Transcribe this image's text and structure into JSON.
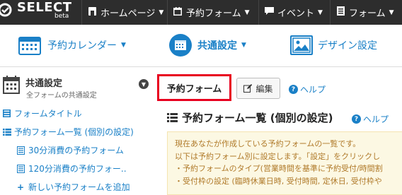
{
  "app": {
    "logo_text": "SELECT",
    "logo_sub": "beta"
  },
  "topnav": [
    {
      "label": "ホームページ",
      "icon": "home-icon"
    },
    {
      "label": "予約フォーム",
      "icon": "calendar-icon"
    },
    {
      "label": "イベント",
      "icon": "chat-icon"
    },
    {
      "label": "フォーム",
      "icon": "form-icon"
    }
  ],
  "subnav": [
    {
      "label": "予約カレンダー",
      "icon": "calendar-grid-icon",
      "dropdown": true
    },
    {
      "label": "共通設定",
      "icon": "calendar-circle-icon",
      "dropdown": true,
      "active": true
    },
    {
      "label": "デザイン設定",
      "icon": "image-icon",
      "dropdown": false
    }
  ],
  "sidebar": {
    "title": "共通設定",
    "subtitle": "全フォームの共通設定",
    "items": [
      {
        "label": "フォームタイトル",
        "icon": "grid-icon"
      },
      {
        "label": "予約フォーム一覧 (個別の設定)",
        "icon": "list-icon"
      },
      {
        "label": "30分消費の予約フォーム",
        "icon": "form-doc-icon"
      },
      {
        "label": "120分消費の予約フォー..",
        "icon": "form-doc-icon"
      },
      {
        "label": "新しい予約フォームを追加",
        "icon": "plus-icon"
      }
    ]
  },
  "main": {
    "form_chip": "予約フォーム",
    "edit_label": "編集",
    "help_label": "ヘルプ",
    "section_title": "予約フォーム一覧 (個別の設定)",
    "section_help": "ヘルプ",
    "notice_lines": [
      "現在あなたが作成している予約フォームの一覧です。",
      "以下は予約フォーム別に設定します。「設定」をクリックし",
      "・予約フォームのタイプ(営業時間を基準に予約受付/時間割",
      "・受付枠の設定 (臨時休業日時, 受付時間, 定休日, 受付枠や"
    ]
  },
  "colors": {
    "topbar": "#2d2d2d",
    "link": "#1a80c7",
    "highlight_border": "#e8001f",
    "notice_bg": "#fcf8e3",
    "notice_text": "#b07a2a"
  }
}
